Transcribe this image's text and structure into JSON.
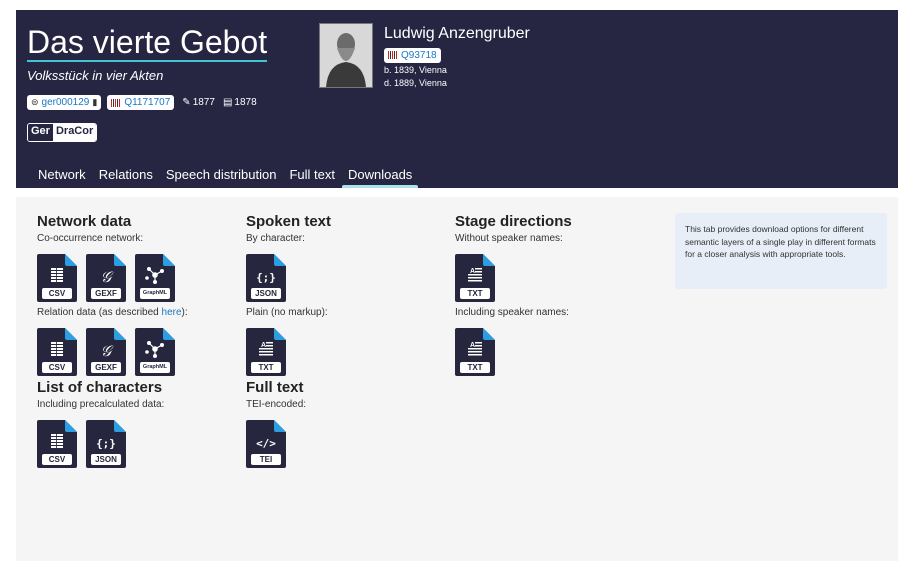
{
  "play": {
    "title": "Das vierte Gebot",
    "subtitle": "Volksstück in vier Akten",
    "dracor_id": "ger000129",
    "wikidata_id": "Q1171707",
    "written_year": "1877",
    "printed_year": "1878",
    "corpus_prefix": "Ger",
    "corpus_name": "DraCor"
  },
  "author": {
    "name": "Ludwig Anzengruber",
    "wikidata_id": "Q93718",
    "born": "b. 1839, Vienna",
    "died": "d. 1889, Vienna"
  },
  "tabs": [
    {
      "label": "Network",
      "active": false
    },
    {
      "label": "Relations",
      "active": false
    },
    {
      "label": "Speech distribution",
      "active": false
    },
    {
      "label": "Full text",
      "active": false
    },
    {
      "label": "Downloads",
      "active": true
    }
  ],
  "downloads": {
    "network": {
      "title": "Network data",
      "cooccurrence_label": "Co-occurrence network:",
      "relation_label": "Relation data (as described ",
      "relation_link": "here",
      "relation_label_end": "):",
      "formats": [
        "CSV",
        "GEXF",
        "GraphML"
      ]
    },
    "characters": {
      "title": "List of characters",
      "label": "Including precalculated data:",
      "formats": [
        "CSV",
        "JSON"
      ]
    },
    "spoken": {
      "title": "Spoken text",
      "by_character_label": "By character:",
      "by_character_format": "JSON",
      "plain_label": "Plain (no markup):",
      "plain_format": "TXT"
    },
    "fulltext": {
      "title": "Full text",
      "label": "TEI-encoded:",
      "format": "TEI"
    },
    "stage": {
      "title": "Stage directions",
      "without_label": "Without speaker names:",
      "without_format": "TXT",
      "with_label": "Including speaker names:",
      "with_format": "TXT"
    }
  },
  "info": "This tab provides download options for different semantic layers of a single play in different formats for a closer analysis with appropriate tools.",
  "colors": {
    "header_bg": "#262542",
    "icon_bg": "#26263e",
    "icon_corner": "#2a9fe3",
    "link": "#1a78c2",
    "tab_indicator": "#a9e4ed"
  }
}
